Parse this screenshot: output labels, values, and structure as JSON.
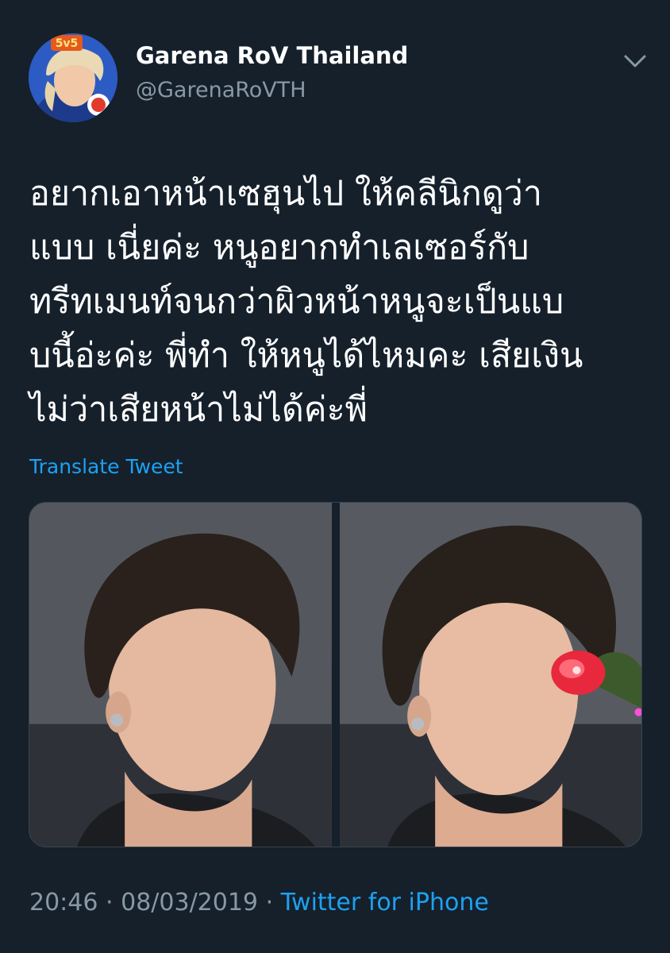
{
  "author": {
    "display_name": "Garena RoV Thailand",
    "handle": "@GarenaRoVTH",
    "avatar_badge_text": "5v5"
  },
  "tweet": {
    "lines": [
      "อยากเอาหน้าเซฮุนไป ให้คลีนิกดูว่า",
      "แบบ เนี่ยค่ะ หนูอยากทำเลเซอร์กับ",
      "ทรีทเมนท์จนกว่าผิวหน้าหนูจะเป็นแบ",
      "บนี้อ่ะค่ะ พี่ทำ ให้หนูได้ไหมคะ เสียเงิน",
      "ไม่ว่าเสียหน้าไม่ได้ค่ะพี่"
    ],
    "translate_label": "Translate Tweet",
    "media": [
      {
        "name": "photo-1"
      },
      {
        "name": "photo-2"
      }
    ]
  },
  "meta": {
    "time": "20:46",
    "separator": "·",
    "date": "08/03/2019",
    "source": "Twitter for iPhone"
  },
  "colors": {
    "background": "#15202b",
    "text_primary": "#ffffff",
    "text_secondary": "#8899a6",
    "accent": "#1da1f2",
    "border": "#38444d"
  },
  "icons": {
    "caret": "chevron-down-icon",
    "avatar": "avatar"
  }
}
